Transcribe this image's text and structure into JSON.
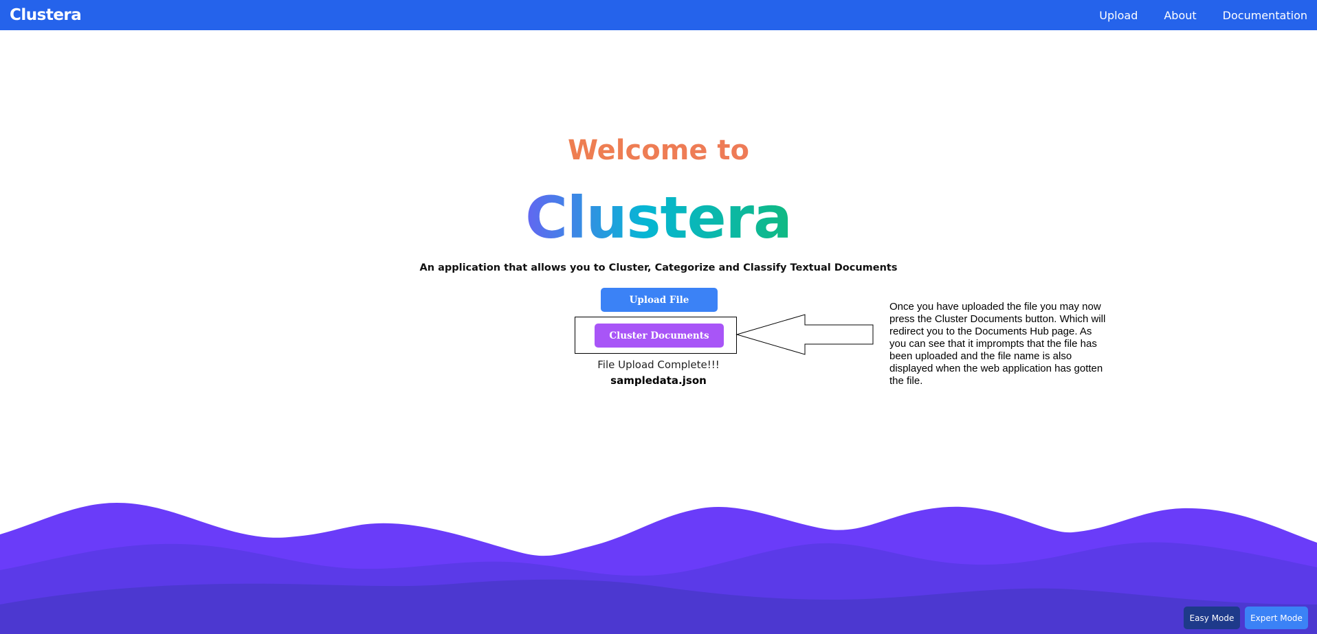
{
  "navbar": {
    "brand": "Clustera",
    "links": [
      "Upload",
      "About",
      "Documentation"
    ]
  },
  "hero": {
    "welcome": "Welcome to",
    "title": "Clustera",
    "subtitle": "An application that allows you to Cluster, Categorize and Classify Textual Documents"
  },
  "actions": {
    "upload_label": "Upload File",
    "cluster_label": "Cluster Documents"
  },
  "upload_status": {
    "message": "File Upload Complete!!!",
    "filename": "sampledata.json"
  },
  "annotation": {
    "text": "Once you have uploaded the file you may now press the Cluster Documents button. Which will redirect you to the Documents Hub page. As you can see that it imprompts that the file has been uploaded and the file name is also displayed when the web application has gotten the file."
  },
  "modes": {
    "easy_label": "Easy Mode",
    "expert_label": "Expert Mode"
  },
  "colors": {
    "navbar": "#2563eb",
    "upload_button": "#3b82f6",
    "cluster_button": "#a855f7",
    "wave_light": "#6a3cf9",
    "wave_mid": "#5b3ae8",
    "wave_dark": "#4c38d0"
  }
}
